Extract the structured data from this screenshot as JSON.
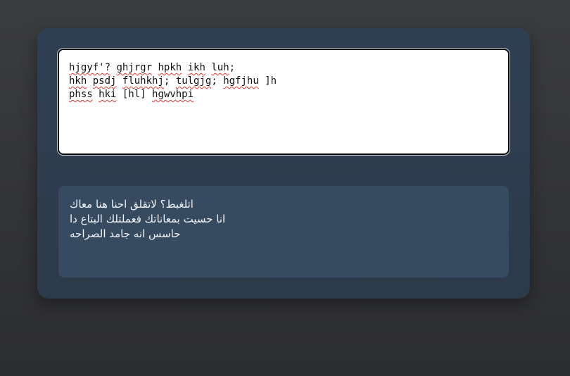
{
  "input": {
    "lines": [
      [
        "hjgyf'?",
        " ",
        "ghjrgr",
        " ",
        "hpkh",
        " ",
        "ikh",
        " ",
        "luh",
        ";"
      ],
      [
        "hkh",
        " ",
        "psdj",
        " ",
        "fluhkhj",
        "; ",
        "tulgjg",
        "; ",
        "hgfjhu",
        " ]h"
      ],
      [
        "phss",
        " ",
        "hki",
        " [hl] ",
        "hgwvhpi",
        "",
        "",
        "",
        "",
        ""
      ]
    ]
  },
  "output": {
    "lines": [
      "اتلغبط؟ لاتقلق احنا هنا معاك",
      "انا حسيت بمعاناتك فعملتلك البتاع دا",
      "حاسس انه جامد الصراحه"
    ]
  }
}
